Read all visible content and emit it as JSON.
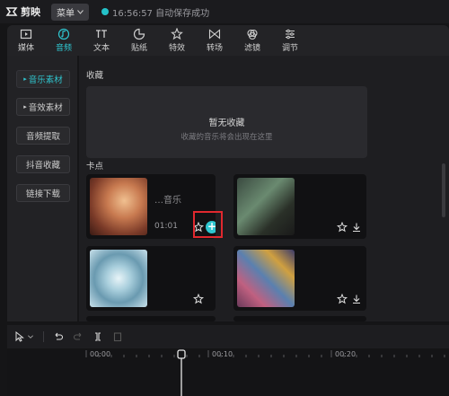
{
  "app": {
    "name": "剪映",
    "menu_label": "菜单",
    "status_text": "16:56:57 自动保存成功"
  },
  "toolbar": {
    "tools": [
      {
        "label": "媒体",
        "icon": "media-icon"
      },
      {
        "label": "音频",
        "icon": "audio-icon",
        "active": true
      },
      {
        "label": "文本",
        "icon": "text-icon"
      },
      {
        "label": "贴纸",
        "icon": "sticker-icon"
      },
      {
        "label": "特效",
        "icon": "effects-icon"
      },
      {
        "label": "转场",
        "icon": "transition-icon"
      },
      {
        "label": "滤镜",
        "icon": "filter-icon"
      },
      {
        "label": "调节",
        "icon": "adjust-icon"
      }
    ]
  },
  "sidebar": {
    "items": [
      {
        "label": "音乐素材",
        "active": true
      },
      {
        "label": "音效素材"
      },
      {
        "label": "音频提取"
      },
      {
        "label": "抖音收藏"
      },
      {
        "label": "链接下载"
      }
    ]
  },
  "favorites": {
    "title": "收藏",
    "empty_title": "暂无收藏",
    "empty_subtitle": "收藏的音乐将会出现在这里"
  },
  "beats": {
    "title": "卡点",
    "cards": [
      {
        "name": "…音乐",
        "duration": "01:01",
        "selected": true
      },
      {
        "name": "",
        "duration": ""
      },
      {
        "name": "",
        "duration": ""
      },
      {
        "name": "",
        "duration": ""
      }
    ]
  },
  "timeline": {
    "ticks": [
      "00:00",
      "00:10",
      "00:20"
    ]
  },
  "colors": {
    "accent": "#2fc6d0",
    "highlight": "#e0282e"
  }
}
